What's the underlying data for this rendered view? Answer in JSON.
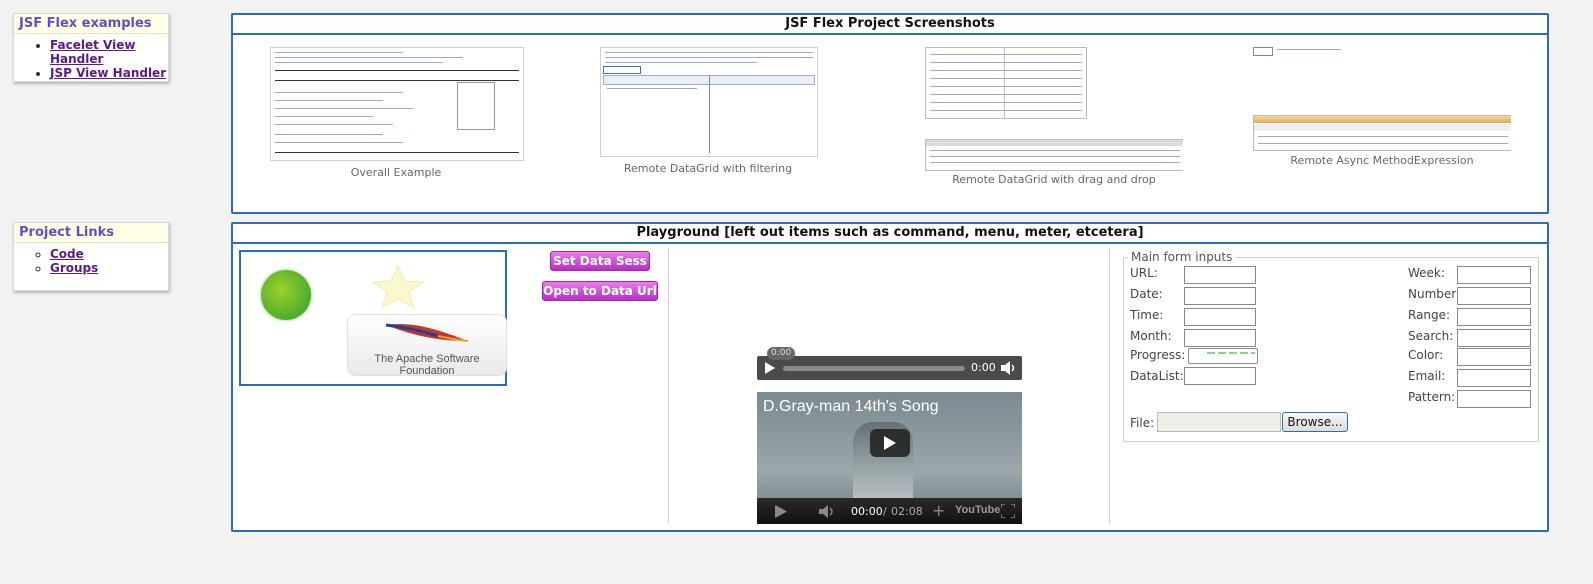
{
  "sidebar": {
    "examples": {
      "title": "JSF Flex examples",
      "links": [
        {
          "label": "Facelet View Handler"
        },
        {
          "label": "JSP View Handler"
        }
      ]
    },
    "project_links": {
      "title": "Project Links",
      "links": [
        {
          "label": "Code"
        },
        {
          "label": "Groups"
        }
      ]
    }
  },
  "screenshots": {
    "title": "JSF Flex Project Screenshots",
    "items": [
      {
        "caption": "Overall Example"
      },
      {
        "caption": "Remote DataGrid with filtering"
      },
      {
        "caption": "Remote DataGrid with drag and drop"
      },
      {
        "caption": "Remote Async MethodExpression"
      }
    ]
  },
  "playground": {
    "title": "Playground [left out items such as command, menu, meter, etcetera]",
    "image_caption": "The Apache Software Foundation",
    "buttons": {
      "set_data": "Set Data Sess",
      "open_url": "Open to Data Url"
    },
    "audio": {
      "tooltip": "0:00",
      "time": "0:00"
    },
    "video": {
      "title": "D.Gray-man 14th's Song",
      "time_current": "00:00",
      "time_sep": "/",
      "time_total": "02:08",
      "brand": "YouTube"
    },
    "form": {
      "legend": "Main form inputs",
      "left_labels": [
        "URL:",
        "Date:",
        "Time:",
        "Month:",
        "Progress:",
        "DataList:"
      ],
      "right_labels": [
        "Week:",
        "Number:",
        "Range:",
        "Search:",
        "Color:",
        "Email:",
        "Pattern:"
      ],
      "file_label": "File:",
      "browse_label": "Browse..."
    }
  },
  "colors": {
    "panel_border": "#2f6bb3",
    "nav_title": "#6a4cc0",
    "link": "#5b1a8a",
    "button_pink": "#d35ad6"
  }
}
